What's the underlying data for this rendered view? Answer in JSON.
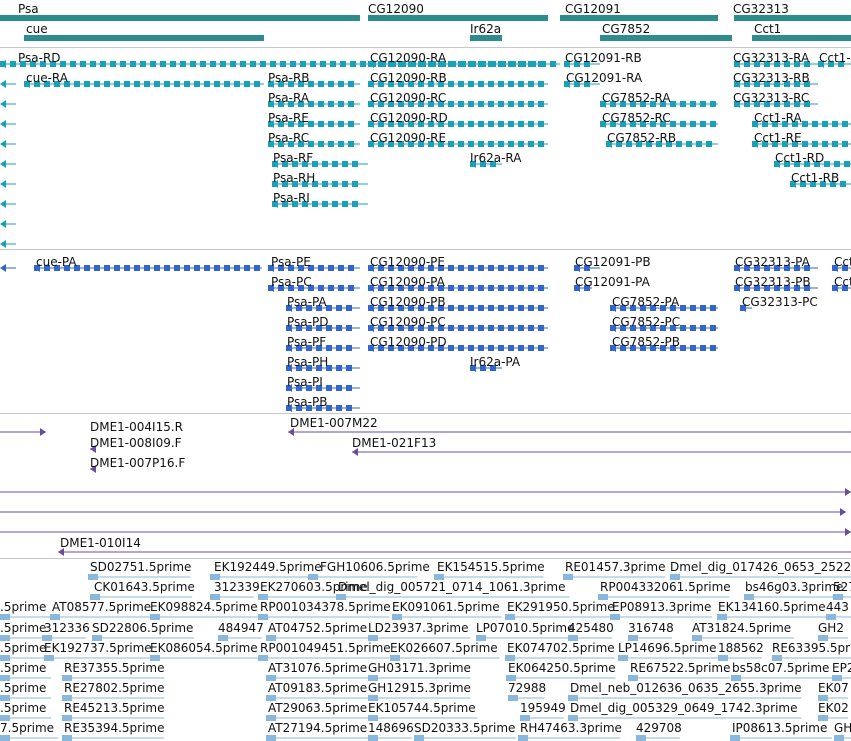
{
  "colors": {
    "gene": "#2e8c8c",
    "transcript_rna": "#1aa0b8",
    "transcript_protein": "#3366cc",
    "clone": "#6a4c9c",
    "est": "#8ab8dc",
    "separator": "#c8c8c8"
  },
  "tracks": {
    "genes": {
      "rows": [
        [
          {
            "label": "Psa"
          },
          {
            "label": "CG12090"
          },
          {
            "label": "CG12091"
          },
          {
            "label": "CG32313"
          }
        ],
        [
          {
            "label": "cue"
          },
          {
            "label": "Ir62a"
          },
          {
            "label": "CG7852"
          },
          {
            "label": "Cct1"
          }
        ]
      ]
    },
    "rna": [
      {
        "label": "Psa-RD"
      },
      {
        "label": "cue-RA"
      },
      {
        "label": "Psa-RB"
      },
      {
        "label": "Psa-RA"
      },
      {
        "label": "Psa-RE"
      },
      {
        "label": "Psa-RC"
      },
      {
        "label": "Psa-RF"
      },
      {
        "label": "Psa-RH"
      },
      {
        "label": "Psa-RI"
      },
      {
        "label": "CG12090-RA"
      },
      {
        "label": "CG12090-RB"
      },
      {
        "label": "CG12090-RC"
      },
      {
        "label": "CG12090-RD"
      },
      {
        "label": "CG12090-RE"
      },
      {
        "label": "Ir62a-RA"
      },
      {
        "label": "CG12091-RB"
      },
      {
        "label": "CG12091-RA"
      },
      {
        "label": "CG7852-RA"
      },
      {
        "label": "CG7852-RC"
      },
      {
        "label": "CG7852-RB"
      },
      {
        "label": "CG32313-RA"
      },
      {
        "label": "CG32313-RB"
      },
      {
        "label": "CG32313-RC"
      },
      {
        "label": "Cct1-RA"
      },
      {
        "label": "Cct1-RE"
      },
      {
        "label": "Cct1-RD"
      },
      {
        "label": "Cct1-RB"
      },
      {
        "label": "Cct1-"
      }
    ],
    "protein": [
      {
        "label": "cue-PA"
      },
      {
        "label": "Psa-PE"
      },
      {
        "label": "Psa-PC"
      },
      {
        "label": "Psa-PA"
      },
      {
        "label": "Psa-PD"
      },
      {
        "label": "Psa-PF"
      },
      {
        "label": "Psa-PH"
      },
      {
        "label": "Psa-PI"
      },
      {
        "label": "Psa-PB"
      },
      {
        "label": "CG12090-PE"
      },
      {
        "label": "CG12090-PA"
      },
      {
        "label": "CG12090-PB"
      },
      {
        "label": "CG12090-PC"
      },
      {
        "label": "CG12090-PD"
      },
      {
        "label": "Ir62a-PA"
      },
      {
        "label": "CG12091-PB"
      },
      {
        "label": "CG12091-PA"
      },
      {
        "label": "CG7852-PA"
      },
      {
        "label": "CG7852-PC"
      },
      {
        "label": "CG7852-PB"
      },
      {
        "label": "CG32313-PA"
      },
      {
        "label": "CG32313-PB"
      },
      {
        "label": "CG32313-PC"
      },
      {
        "label": "Cct"
      },
      {
        "label": "Cct"
      }
    ],
    "clones": [
      {
        "label": "DME1-004I15.R"
      },
      {
        "label": "DME1-008I09.F"
      },
      {
        "label": "DME1-007P16.F"
      },
      {
        "label": "DME1-007M22"
      },
      {
        "label": "DME1-021F13"
      },
      {
        "label": "DME1-010I14"
      }
    ],
    "ests": [
      {
        "label": "SD02751.5prime"
      },
      {
        "label": "EK192449.5prime"
      },
      {
        "label": "FGH10606.5prime"
      },
      {
        "label": "EK154515.5prime"
      },
      {
        "label": "RE01457.3prime"
      },
      {
        "label": "Dmel_dig_017426_0653_2522"
      },
      {
        "label": "CK01643.5prime"
      },
      {
        "label": "312339"
      },
      {
        "label": "EK270603.5prime"
      },
      {
        "label": "Dmel_dig_005721_0714_1061.3prime"
      },
      {
        "label": "RP004332061.5prime"
      },
      {
        "label": "bs46g03.3prime"
      },
      {
        "label": "527"
      },
      {
        "label": ".5prime"
      },
      {
        "label": "AT08577.5prime"
      },
      {
        "label": "EK098824.5prime"
      },
      {
        "label": "RP001034378.5prime"
      },
      {
        "label": "EK091061.5prime"
      },
      {
        "label": "EK291950.5prime"
      },
      {
        "label": "EP08913.3prime"
      },
      {
        "label": "EK134160.5prime"
      },
      {
        "label": "443"
      },
      {
        "label": ".5prime"
      },
      {
        "label": "312336"
      },
      {
        "label": "SD22806.5prime"
      },
      {
        "label": "484947"
      },
      {
        "label": "AT04752.5prime"
      },
      {
        "label": "LD23937.3prime"
      },
      {
        "label": "LP07010.5prime"
      },
      {
        "label": "425480"
      },
      {
        "label": "316748"
      },
      {
        "label": "AT31824.5prime"
      },
      {
        "label": "GH2"
      },
      {
        "label": ".5prime"
      },
      {
        "label": "EK192737.5prime"
      },
      {
        "label": "EK086054.5prime"
      },
      {
        "label": "RP001049451.5prime"
      },
      {
        "label": "EK026607.5prime"
      },
      {
        "label": "EK074702.5prime"
      },
      {
        "label": "LP14696.5prime"
      },
      {
        "label": "188562"
      },
      {
        "label": "RE63395.5prime"
      },
      {
        "label": ".5prime"
      },
      {
        "label": "RE37355.5prime"
      },
      {
        "label": "AT31076.5prime"
      },
      {
        "label": "GH03171.3prime"
      },
      {
        "label": "EK064250.5prime"
      },
      {
        "label": "RE67522.5prime"
      },
      {
        "label": "bs58c07.5prime"
      },
      {
        "label": "EP2"
      },
      {
        "label": ".5prime"
      },
      {
        "label": "RE27802.5prime"
      },
      {
        "label": "AT09183.5prime"
      },
      {
        "label": "GH12915.3prime"
      },
      {
        "label": "72988"
      },
      {
        "label": "Dmel_neb_012636_0635_2655.3prime"
      },
      {
        "label": "EK07"
      },
      {
        "label": ".5prime"
      },
      {
        "label": "RE45213.5prime"
      },
      {
        "label": "AT29063.5prime"
      },
      {
        "label": "EK105744.5prime"
      },
      {
        "label": "195949"
      },
      {
        "label": "Dmel_dig_005329_0649_1742.3prime"
      },
      {
        "label": "EK02"
      },
      {
        "label": "7.5prime"
      },
      {
        "label": "RE35394.5prime"
      },
      {
        "label": "AT27194.5prime"
      },
      {
        "label": "148696"
      },
      {
        "label": "SD20333.5prime"
      },
      {
        "label": "RH47463.3prime"
      },
      {
        "label": "429708"
      },
      {
        "label": "IP08613.5prime"
      },
      {
        "label": "GH6"
      }
    ]
  }
}
